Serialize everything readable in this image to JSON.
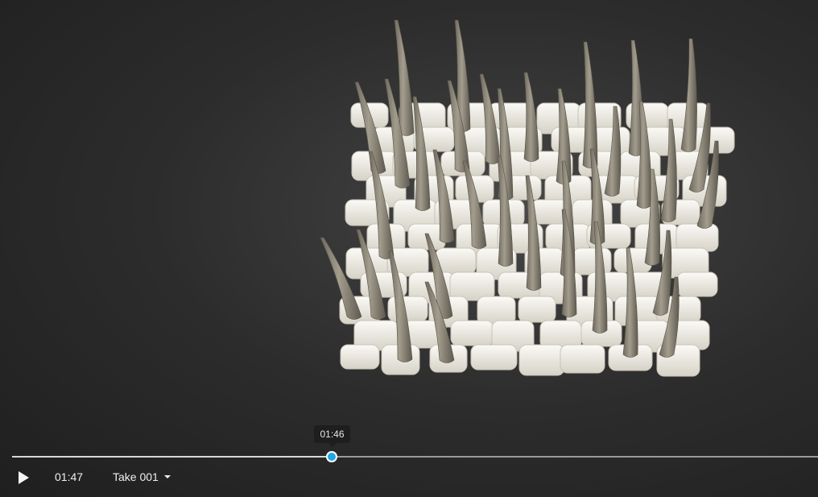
{
  "animation": {
    "current_time": "01:47",
    "hover_time": "01:46",
    "progress_fraction": 0.397,
    "take_label": "Take 001"
  },
  "icons": {
    "play": "play-icon",
    "dropdown": "caret-down-icon"
  },
  "colors": {
    "background": "#2a2a2a",
    "scale_base": "#ece9e1",
    "hair_strand": "#8a8476",
    "timeline_knob": "#1ea7e8"
  }
}
